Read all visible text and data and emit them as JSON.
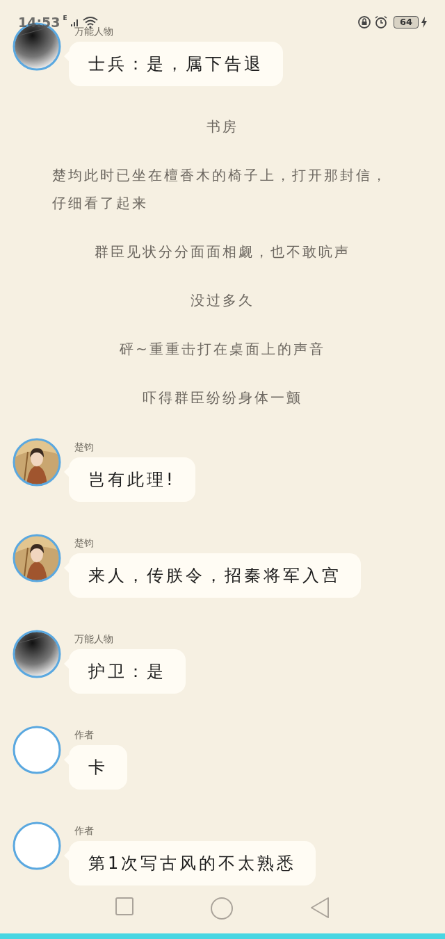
{
  "status_bar": {
    "time": "14:53",
    "network": "E",
    "battery": "64",
    "charging": true
  },
  "feed": [
    {
      "kind": "message",
      "sender": "万能人物",
      "avatar": {
        "kind": "dark"
      },
      "text": "士兵：是，属下告退"
    },
    {
      "kind": "narration",
      "text": "书房"
    },
    {
      "kind": "narration",
      "text": "楚均此时已坐在檀香木的椅子上，打开那封信，仔细看了起来"
    },
    {
      "kind": "narration",
      "text": "群臣见状分分面面相觑，也不敢吭声"
    },
    {
      "kind": "narration",
      "text": "没过多久"
    },
    {
      "kind": "narration",
      "text": "砰~重重击打在桌面上的声音"
    },
    {
      "kind": "narration",
      "text": "吓得群臣纷纷身体一颤"
    },
    {
      "kind": "message",
      "sender": "楚钧",
      "avatar": {
        "kind": "figure"
      },
      "text": "岂有此理!"
    },
    {
      "kind": "message",
      "sender": "楚钧",
      "avatar": {
        "kind": "figure"
      },
      "text": "来人，传朕令，招秦将军入宫"
    },
    {
      "kind": "message",
      "sender": "万能人物",
      "avatar": {
        "kind": "dark"
      },
      "text": "护卫：是"
    },
    {
      "kind": "message",
      "sender": "作者",
      "avatar": {
        "kind": "blank"
      },
      "text": "卡"
    },
    {
      "kind": "message",
      "sender": "作者",
      "avatar": {
        "kind": "blank"
      },
      "text": "第1次写古风的不太熟悉"
    }
  ]
}
